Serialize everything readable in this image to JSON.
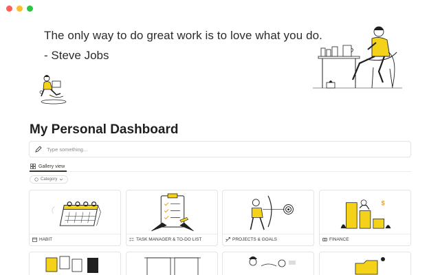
{
  "window": {
    "controls": [
      "close",
      "minimize",
      "maximize"
    ]
  },
  "header": {
    "quote": "The only way to do great work is to love what you do.",
    "author": "- Steve Jobs"
  },
  "page": {
    "title": "My Personal Dashboard"
  },
  "input": {
    "placeholder": "Type something..."
  },
  "view": {
    "tab_label": "Gallery view",
    "filter_label": "Category"
  },
  "cards": [
    {
      "label": "HABIT",
      "icon": "calendar-icon"
    },
    {
      "label": "TASK MANAGER & TO-DO LIST",
      "icon": "checklist-icon"
    },
    {
      "label": "PROJECTS & GOALS",
      "icon": "target-icon"
    },
    {
      "label": "FINANCE",
      "icon": "money-icon"
    }
  ],
  "colors": {
    "accent": "#f5d21a",
    "ink": "#1f1f1f",
    "border": "#e3e3e1"
  }
}
